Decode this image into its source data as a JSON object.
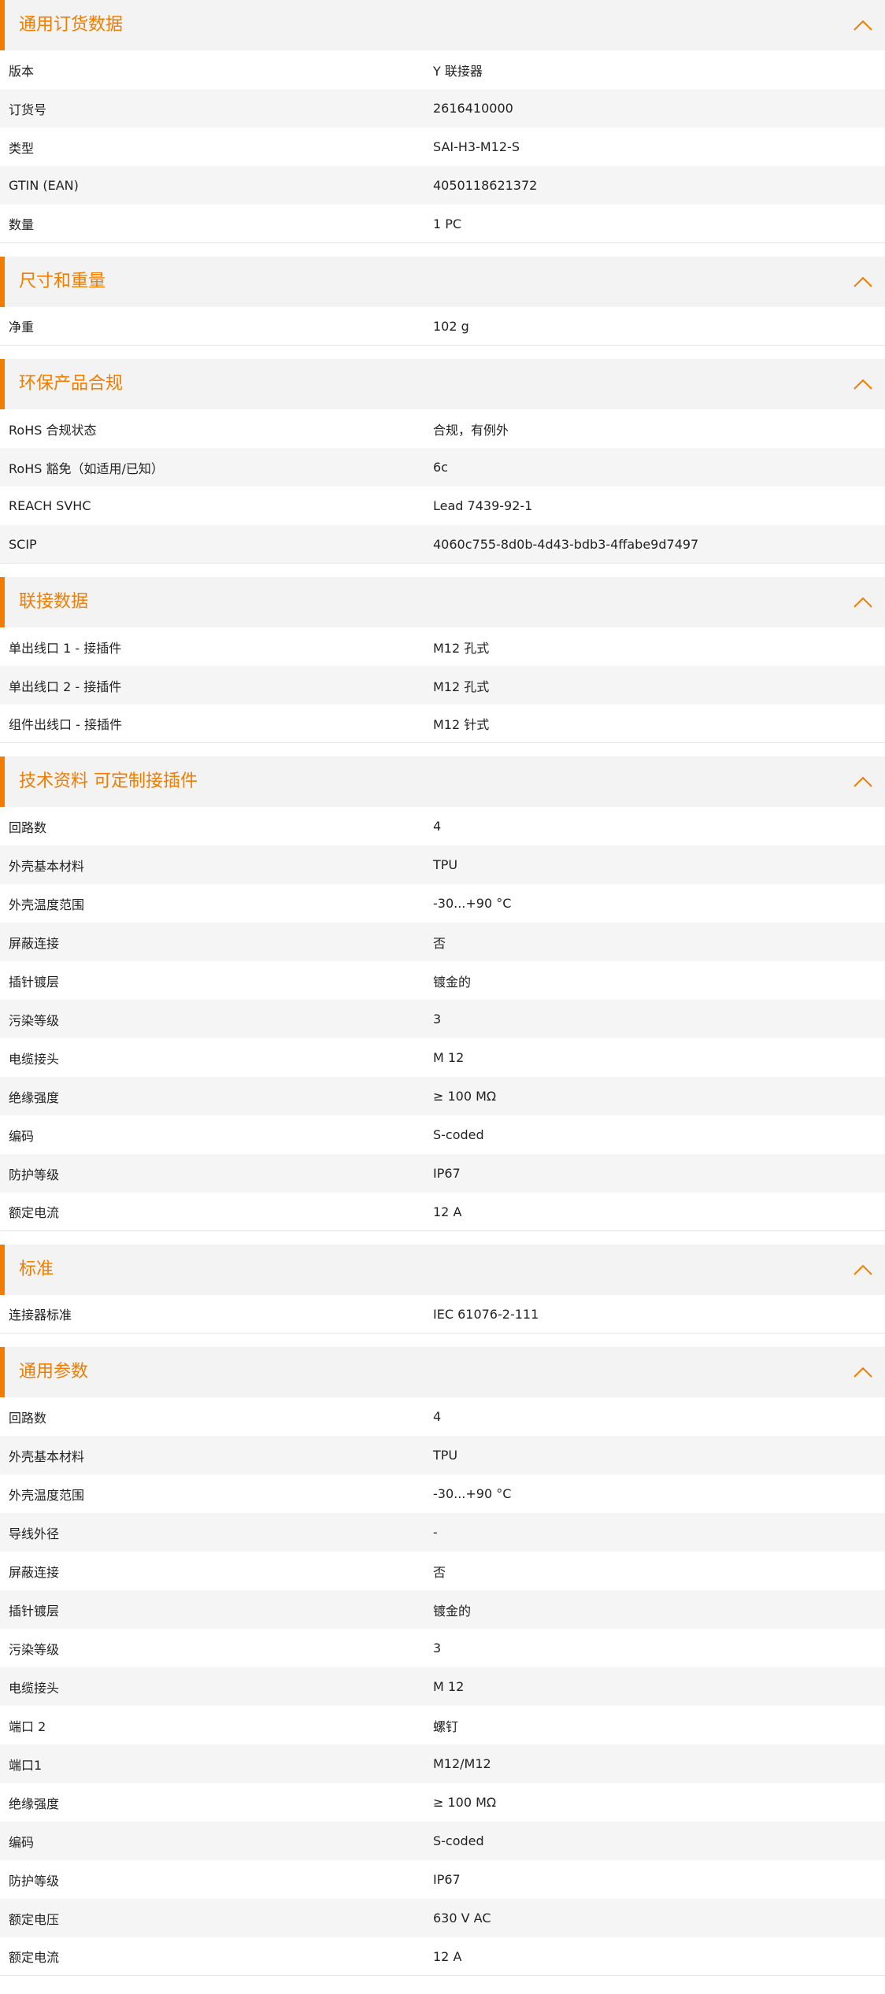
{
  "colors": {
    "accent": "#f07d00",
    "header_bg": "#f3f3f3",
    "row_alt_bg": "#f5f5f5"
  },
  "icons": {
    "collapse": "chevron-up-icon"
  },
  "sections": [
    {
      "title": "通用订货数据",
      "rows": [
        {
          "label": "版本",
          "value": "Y 联接器"
        },
        {
          "label": "订货号",
          "value": "2616410000"
        },
        {
          "label": "类型",
          "value": "SAI-H3-M12-S"
        },
        {
          "label": "GTIN (EAN)",
          "value": "4050118621372"
        },
        {
          "label": "数量",
          "value": "1  PC"
        }
      ]
    },
    {
      "title": "尺寸和重量",
      "rows": [
        {
          "label": "净重",
          "value": "102  g"
        }
      ]
    },
    {
      "title": "环保产品合规",
      "rows": [
        {
          "label": "RoHS 合规状态",
          "value": "合规，有例外"
        },
        {
          "label": "RoHS 豁免（如适用/已知）",
          "value": "6c"
        },
        {
          "label": "REACH SVHC",
          "value": "Lead 7439-92-1"
        },
        {
          "label": "SCIP",
          "value": "4060c755-8d0b-4d43-bdb3-4ffabe9d7497"
        }
      ]
    },
    {
      "title": "联接数据",
      "rows": [
        {
          "label": "单出线口 1 - 接插件",
          "value": "M12 孔式"
        },
        {
          "label": "单出线口 2 - 接插件",
          "value": "M12 孔式"
        },
        {
          "label": "组件出线口 - 接插件",
          "value": "M12 针式"
        }
      ]
    },
    {
      "title": "技术资料 可定制接插件",
      "rows": [
        {
          "label": "回路数",
          "value": "4"
        },
        {
          "label": "外壳基本材料",
          "value": "TPU"
        },
        {
          "label": "外壳温度范围",
          "value": "-30...+90 °C"
        },
        {
          "label": "屏蔽连接",
          "value": "否"
        },
        {
          "label": "插针镀层",
          "value": "镀金的"
        },
        {
          "label": "污染等级",
          "value": "3"
        },
        {
          "label": "电缆接头",
          "value": "M 12"
        },
        {
          "label": "绝缘强度",
          "value": "≥ 100 MΩ"
        },
        {
          "label": "编码",
          "value": "S-coded"
        },
        {
          "label": "防护等级",
          "value": "IP67"
        },
        {
          "label": "额定电流",
          "value": "12  A"
        }
      ]
    },
    {
      "title": "标准",
      "rows": [
        {
          "label": "连接器标准",
          "value": "IEC 61076-2-111"
        }
      ]
    },
    {
      "title": "通用参数",
      "rows": [
        {
          "label": "回路数",
          "value": "4"
        },
        {
          "label": "外壳基本材料",
          "value": "TPU"
        },
        {
          "label": "外壳温度范围",
          "value": "-30...+90 °C"
        },
        {
          "label": "导线外径",
          "value": "-"
        },
        {
          "label": "屏蔽连接",
          "value": "否"
        },
        {
          "label": "插针镀层",
          "value": "镀金的"
        },
        {
          "label": "污染等级",
          "value": "3"
        },
        {
          "label": "电缆接头",
          "value": "M 12"
        },
        {
          "label": "端口 2",
          "value": "螺钉"
        },
        {
          "label": "端口1",
          "value": "M12/M12"
        },
        {
          "label": "绝缘强度",
          "value": "≥ 100 MΩ"
        },
        {
          "label": "编码",
          "value": "S-coded"
        },
        {
          "label": "防护等级",
          "value": "IP67"
        },
        {
          "label": "额定电压",
          "value": "630 V AC"
        },
        {
          "label": "额定电流",
          "value": "12  A"
        }
      ]
    }
  ]
}
